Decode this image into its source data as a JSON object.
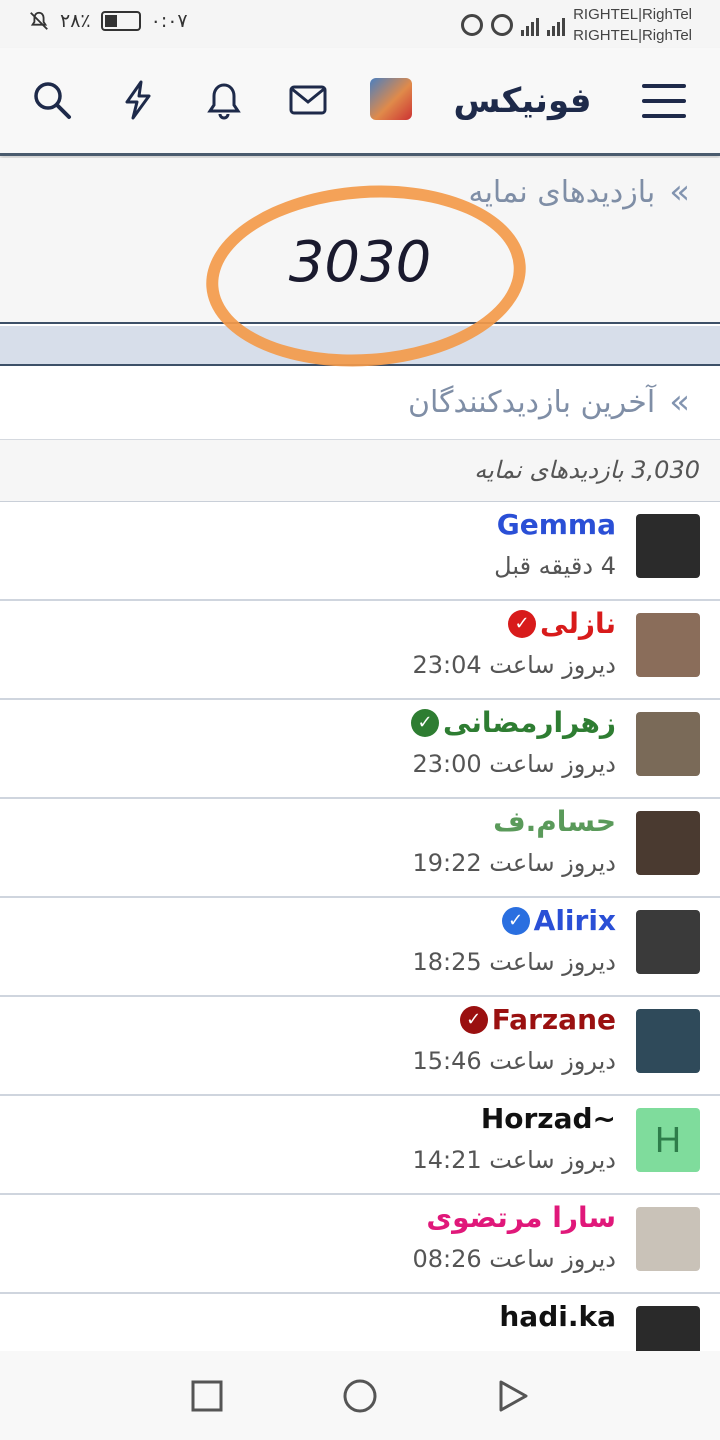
{
  "status_bar": {
    "time": "۰:۰۷",
    "battery": "۲۸٪",
    "carrier_1": "RIGHTEL|RighTel",
    "carrier_2": "RIGHTEL|RighTel",
    "network_1": "4G",
    "network_2": "4G"
  },
  "header": {
    "logo_text": "فونیکس",
    "icons": [
      "search-icon",
      "lightning-icon",
      "bell-icon",
      "mail-icon",
      "user-avatar",
      "menu-icon"
    ]
  },
  "profile_views": {
    "title": "بازدیدهای نمایه",
    "count": "3030",
    "arrow": "»"
  },
  "last_visitors": {
    "title": "آخرین بازدیدکنندگان",
    "arrow": "»",
    "summary": "3,030 بازدیدهای نمایه"
  },
  "visitors": [
    {
      "name": "Gemma",
      "time": "4 دقیقه قبل",
      "color": "#2a4fd6",
      "badge": ""
    },
    {
      "name": "نازلی",
      "time": "دیروز ساعت 23:04",
      "color": "#d81b1b",
      "badge": "red"
    },
    {
      "name": "زهرارمضانی",
      "time": "دیروز ساعت 23:00",
      "color": "#2e7d32",
      "badge": "green"
    },
    {
      "name": "حسام.ف",
      "time": "دیروز ساعت 19:22",
      "color": "#5a9a5a",
      "badge": ""
    },
    {
      "name": "Alirix",
      "time": "دیروز ساعت 18:25",
      "color": "#2a4fd6",
      "badge": "blue"
    },
    {
      "name": "Farzane",
      "time": "دیروز ساعت 15:46",
      "color": "#9a1010",
      "badge": "darkred"
    },
    {
      "name": "~Horzad",
      "time": "دیروز ساعت 14:21",
      "color": "#111111",
      "badge": "",
      "avatar_letter": "H"
    },
    {
      "name": "سارا مرتضوی",
      "time": "دیروز ساعت 08:26",
      "color": "#e0187a",
      "badge": ""
    },
    {
      "name": "hadi.ka",
      "time": "",
      "color": "#111111",
      "badge": ""
    }
  ],
  "colors": {
    "accent": "#4a5b6e",
    "section_title": "#7f8ea6",
    "highlight_circle": "#f39a4a",
    "separator_band": "#d7deea"
  }
}
